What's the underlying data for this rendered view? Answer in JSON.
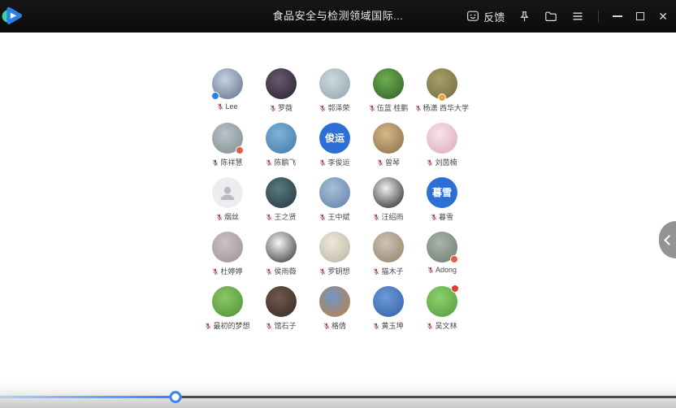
{
  "window": {
    "title": "食品安全与检测领域国际..."
  },
  "titlebar": {
    "feedback_label": "反馈",
    "buttons": [
      "feedback",
      "pin",
      "folder",
      "menu",
      "minimize",
      "maximize",
      "close"
    ]
  },
  "participants": [
    {
      "name": "Lee",
      "mic": "#9a4a4a",
      "avatar": {
        "type": "photo",
        "bg": [
          "#c7d2e2",
          "#5f6e88"
        ]
      },
      "badge": {
        "pos": "bl",
        "color": "#2f7fe8"
      }
    },
    {
      "name": "罗薇",
      "mic": "#9a4a4a",
      "avatar": {
        "type": "photo",
        "bg": [
          "#6b5a6e",
          "#241f2e"
        ]
      },
      "badge": null
    },
    {
      "name": "郭泽荣",
      "mic": "#9a4a4a",
      "avatar": {
        "type": "photo",
        "bg": [
          "#cfd9de",
          "#8fa3ad"
        ]
      },
      "badge": null
    },
    {
      "name": "伍蓝 桂鹏",
      "mic": "#9a4a4a",
      "avatar": {
        "type": "photo",
        "bg": [
          "#6fae4e",
          "#2e5c28"
        ]
      },
      "badge": null
    },
    {
      "name": "杨潇 西华大学",
      "mic": "#9a4a4a",
      "avatar": {
        "type": "photo",
        "bg": [
          "#a8a06a",
          "#6e6a3c"
        ]
      },
      "badge": {
        "pos": "bc",
        "color": "#f2a33c"
      }
    },
    {
      "name": "陈祥慧",
      "mic": "#555555",
      "avatar": {
        "type": "photo",
        "bg": [
          "#b9c2c6",
          "#7f8d93"
        ]
      },
      "badge": {
        "pos": "br",
        "color": "#e85a4a"
      }
    },
    {
      "name": "陈鹏飞",
      "mic": "#9a4a4a",
      "avatar": {
        "type": "photo",
        "bg": [
          "#7fb3d8",
          "#3f78a8"
        ]
      },
      "badge": null
    },
    {
      "name": "李俊运",
      "mic": "#9a4a4a",
      "avatar": {
        "type": "text",
        "bg": "#2e6fd6",
        "text": "俊运"
      },
      "badge": null
    },
    {
      "name": "曾琴",
      "mic": "#9a4a4a",
      "avatar": {
        "type": "photo",
        "bg": [
          "#d8b98a",
          "#8a6a42"
        ]
      },
      "badge": null
    },
    {
      "name": "刘茵楠",
      "mic": "#9a4a4a",
      "avatar": {
        "type": "photo",
        "bg": [
          "#f6e3e8",
          "#dbaab6"
        ]
      },
      "badge": null
    },
    {
      "name": "烟丝",
      "mic": "#9a4a4a",
      "avatar": {
        "type": "default",
        "bg": "#ecedef"
      },
      "badge": null
    },
    {
      "name": "王之贤",
      "mic": "#9a4a4a",
      "avatar": {
        "type": "photo",
        "bg": [
          "#5a7a80",
          "#23343a"
        ]
      },
      "badge": null
    },
    {
      "name": "王中斌",
      "mic": "#9a4a4a",
      "avatar": {
        "type": "photo",
        "bg": [
          "#a8c0d8",
          "#5f7ea6"
        ]
      },
      "badge": null
    },
    {
      "name": "汪绍雨",
      "mic": "#9a4a4a",
      "avatar": {
        "type": "photo",
        "bg": [
          "#f0f0f0",
          "#1f1f1f"
        ]
      },
      "badge": null
    },
    {
      "name": "暮雪",
      "mic": "#9a4a4a",
      "avatar": {
        "type": "text",
        "bg": "#2e6fd6",
        "text": "暮雪"
      },
      "badge": null
    },
    {
      "name": "杜婷婷",
      "mic": "#9a4a4a",
      "avatar": {
        "type": "photo",
        "bg": [
          "#cdc0c6",
          "#9d8f96"
        ]
      },
      "badge": null
    },
    {
      "name": "侯雨薇",
      "mic": "#9a4a4a",
      "avatar": {
        "type": "photo",
        "bg": [
          "#f5f5f5",
          "#2e2e2e"
        ]
      },
      "badge": null
    },
    {
      "name": "罗钥想",
      "mic": "#9a4a4a",
      "avatar": {
        "type": "photo",
        "bg": [
          "#efe9da",
          "#b8b2a0"
        ]
      },
      "badge": null
    },
    {
      "name": "猫木子",
      "mic": "#9a4a4a",
      "avatar": {
        "type": "photo",
        "bg": [
          "#cfc4b4",
          "#8f7f66"
        ]
      },
      "badge": null
    },
    {
      "name": "Adong",
      "mic": "#9a4a4a",
      "avatar": {
        "type": "photo",
        "bg": [
          "#aab4ab",
          "#6d7a6e"
        ]
      },
      "badge": {
        "pos": "br",
        "color": "#e85a4a"
      }
    },
    {
      "name": "最初的梦想",
      "mic": "#9a4a4a",
      "avatar": {
        "type": "photo",
        "bg": [
          "#8cc763",
          "#4e8f3a"
        ]
      },
      "badge": null
    },
    {
      "name": "馆石子",
      "mic": "#9a4a4a",
      "avatar": {
        "type": "photo",
        "bg": [
          "#6e5a50",
          "#38281f"
        ]
      },
      "badge": null
    },
    {
      "name": "格倩",
      "mic": "#9a4a4a",
      "avatar": {
        "type": "photo",
        "bg": [
          "#6f98c8",
          "#c07f3a"
        ]
      },
      "badge": null
    },
    {
      "name": "黄玉坤",
      "mic": "#9a4a4a",
      "avatar": {
        "type": "photo",
        "bg": [
          "#6f9ad8",
          "#2f5fa8"
        ]
      },
      "badge": null
    },
    {
      "name": "吴文林",
      "mic": "#9a4a4a",
      "avatar": {
        "type": "photo",
        "bg": [
          "#8ed06a",
          "#4f9c3e"
        ]
      },
      "badge": {
        "pos": "tr",
        "color": "#e03c2f"
      }
    }
  ],
  "player": {
    "progress_percent": 26,
    "fill_start": "#a9d2f7",
    "fill_end": "#2f80ff",
    "track_color": "#4a4a46",
    "handle_border": "#3b86f0"
  }
}
